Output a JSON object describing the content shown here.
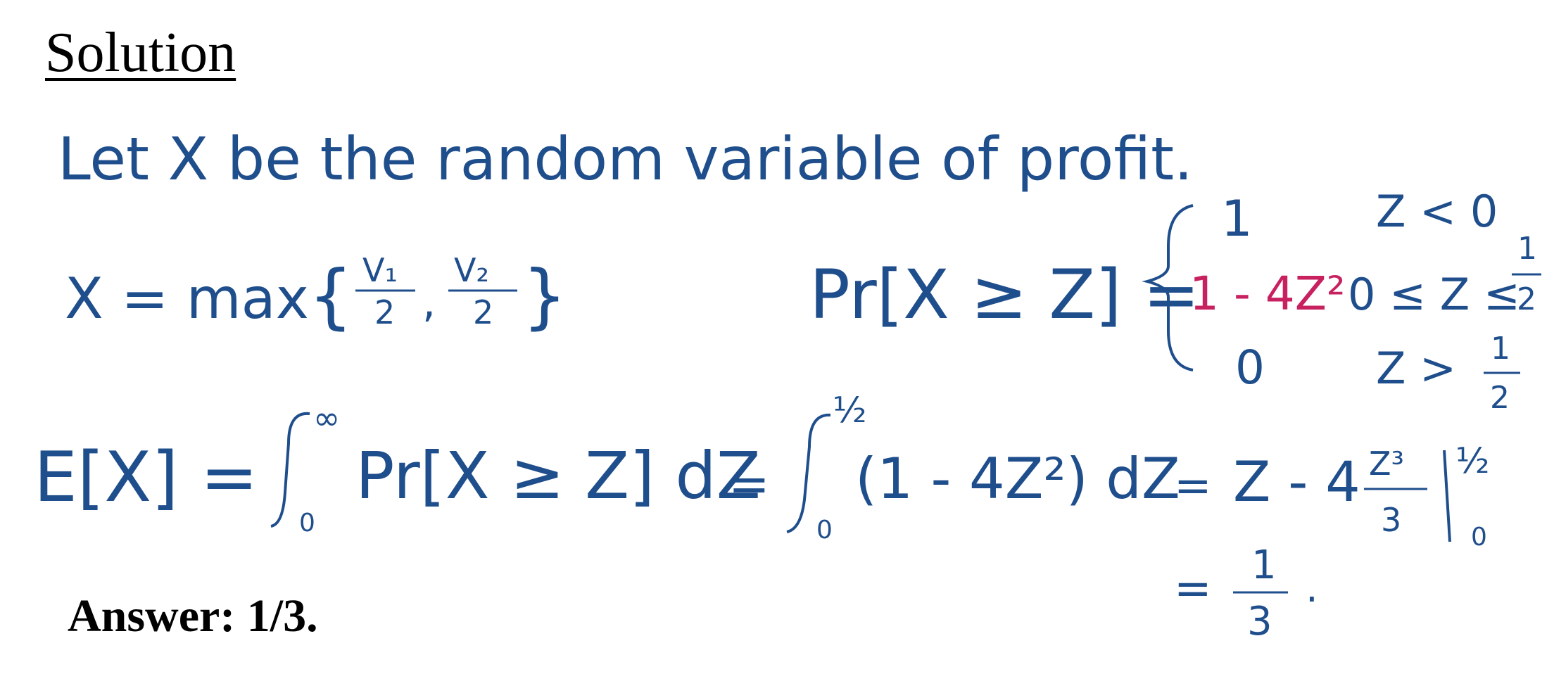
{
  "heading": "Solution",
  "handwriting": {
    "intro": "Let X be the random variable of profit.",
    "x_def": {
      "lhs": "X = max",
      "v1": "V₁",
      "v2": "V₂",
      "den": "2"
    },
    "prob": {
      "lhs": "Pr[X ≥ Z] =",
      "case1_value": "1",
      "case1_cond": "Z < 0",
      "case2_value": "1 - 4Z²",
      "case2_cond": "0 ≤ Z ≤",
      "case3_value": "0",
      "case3_cond": "Z >",
      "half_num": "1",
      "half_den": "2"
    },
    "expect": {
      "lhs": "E[X] =",
      "int1_upper": "∞",
      "int1_lower": "0",
      "integrand1": "Pr[X ≥ Z] dZ",
      "eq": "=",
      "int2_upper": "½",
      "int2_lower": "0",
      "integrand2": "(1 - 4Z²) dZ",
      "eq2": "=",
      "antideriv": "Z - 4",
      "frac_num": "Z³",
      "frac_den": "3",
      "eval_upper": "½",
      "eval_lower": "0",
      "result_eq": "=",
      "result_num": "1",
      "result_den": "3",
      "result_dot": "."
    }
  },
  "answer": "Answer: 1/3.",
  "colors": {
    "ink_blue": "#1f4e8c",
    "ink_magenta": "#c8215f",
    "text_black": "#000000"
  }
}
